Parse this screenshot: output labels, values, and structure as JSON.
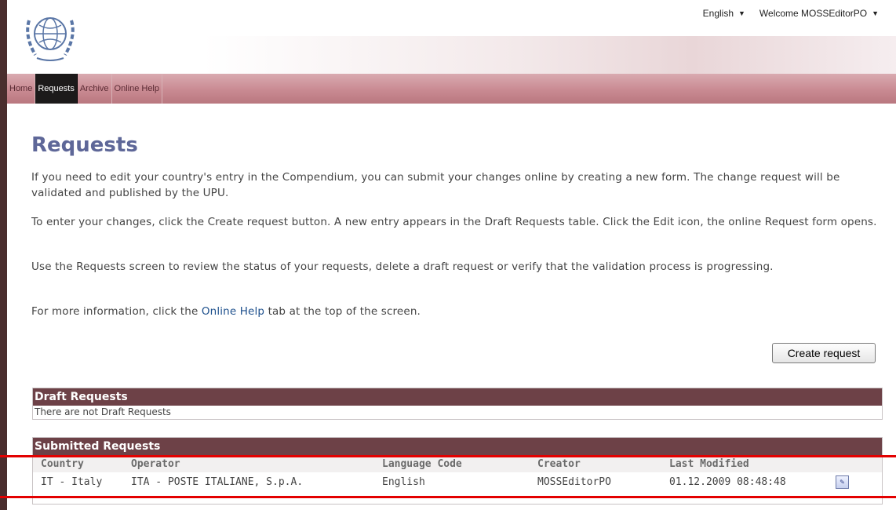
{
  "header": {
    "language": "English",
    "welcome": "Welcome MOSSEditorPO"
  },
  "nav": {
    "items": [
      {
        "label": "Home"
      },
      {
        "label": "Requests"
      },
      {
        "label": "Archive"
      },
      {
        "label": "Online Help"
      }
    ],
    "active": "Requests"
  },
  "main": {
    "title": "Requests",
    "p1": "If you need to edit your country's entry in the Compendium, you can submit your changes online by creating a new form. The change request will be validated and published by the UPU.",
    "p2": "To enter your changes, click the Create request button. A new entry appears in the Draft Requests table. Click the Edit icon, the online Request form opens.",
    "p3": "Use the Requests screen to review the status of your requests, delete a draft request or verify that the validation process is progressing.",
    "p4_before": "For more information, click the ",
    "p4_link": "Online Help",
    "p4_after": " tab at the top of the screen.",
    "create_button": "Create request"
  },
  "draft": {
    "title": "Draft Requests",
    "empty": "There are not Draft Requests"
  },
  "submitted": {
    "title": "Submitted Requests",
    "columns": [
      "Country",
      "Operator",
      "Language Code",
      "Creator",
      "Last Modified"
    ],
    "rows": [
      {
        "country": "IT - Italy",
        "operator": "ITA - POSTE ITALIANE, S.p.A.",
        "language": "English",
        "creator": "MOSSEditorPO",
        "modified": "01.12.2009 08:48:48"
      }
    ]
  },
  "colors": {
    "title": "#5e6798",
    "nav": "#c98a92",
    "panel_header": "#6d4147",
    "highlight": "#e30000"
  },
  "icons": [
    "un-emblem-logo",
    "edit-icon"
  ]
}
